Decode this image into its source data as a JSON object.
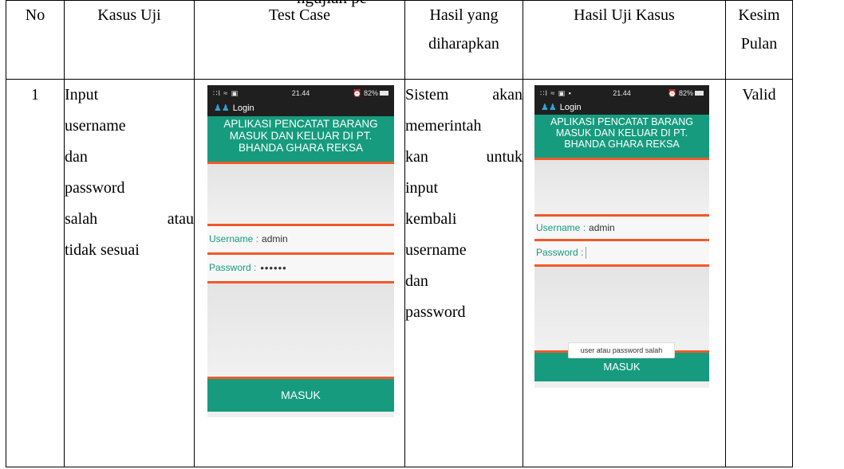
{
  "top_cut_text": "ngujian pe",
  "table": {
    "headers": {
      "no": "No",
      "kasus_uji": "Kasus Uji",
      "test_case": "Test Case",
      "hasil_diharapkan": [
        "Hasil yang",
        "diharapkan"
      ],
      "hasil_uji": "Hasil Uji Kasus",
      "kesimpulan": [
        "Kesim",
        "Pulan"
      ]
    },
    "row": {
      "no": "1",
      "kasus_uji_lines": [
        "Input",
        "username",
        "dan",
        "password",
        "salah atau",
        "tidak sesuai"
      ],
      "hasil_lines": [
        "Sistem akan",
        "memerintah",
        "kan untuk",
        "input",
        "kembali",
        "username",
        "dan",
        "password"
      ],
      "kesimpulan": "Valid"
    }
  },
  "phone_test": {
    "status_signal": "∷l ≈ ▣",
    "status_time": "21.44",
    "status_battery": "⏰ 82%",
    "app_title": "Login",
    "banner": [
      "APLIKASI PENCATAT BARANG",
      "MASUK DAN KELUAR DI PT.",
      "BHANDA GHARA REKSA"
    ],
    "username_label": "Username :",
    "username_value": "admin",
    "password_label": "Password :",
    "password_value": "••••••",
    "button": "MASUK"
  },
  "phone_result": {
    "status_signal": "∷l ≈ ▣ ▪",
    "status_time": "21.44",
    "status_battery": "⏰ 82%",
    "app_title": "Login",
    "banner": [
      "APLIKASI PENCATAT BARANG",
      "MASUK DAN KELUAR DI PT.",
      "BHANDA GHARA REKSA"
    ],
    "username_label": "Username :",
    "username_value": "admin",
    "password_label": "Password :",
    "toast": "user atau password salah",
    "button": "MASUK"
  },
  "icons": {
    "login": "users-icon"
  }
}
